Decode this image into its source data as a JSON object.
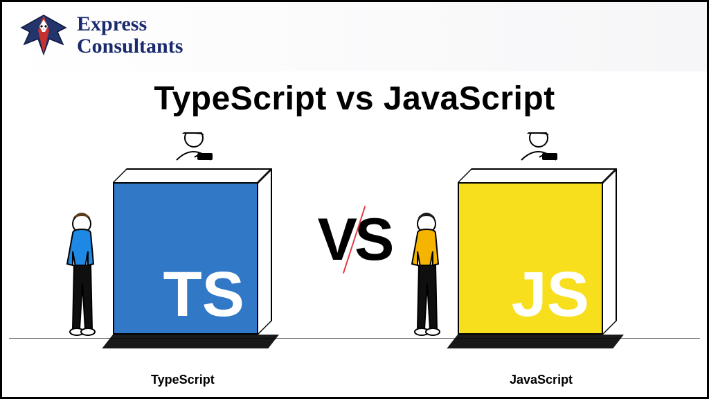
{
  "brand": {
    "line1": "Express",
    "line2": "Consultants"
  },
  "title": "TypeScript vs JavaScript",
  "vs": "VS",
  "left": {
    "box_label": "TS",
    "caption": "TypeScript",
    "box_color": "#3178c6",
    "shirt": "#1e88e5"
  },
  "right": {
    "box_label": "JS",
    "caption": "JavaScript",
    "box_color": "#f7df1e",
    "shirt": "#f4b400"
  }
}
